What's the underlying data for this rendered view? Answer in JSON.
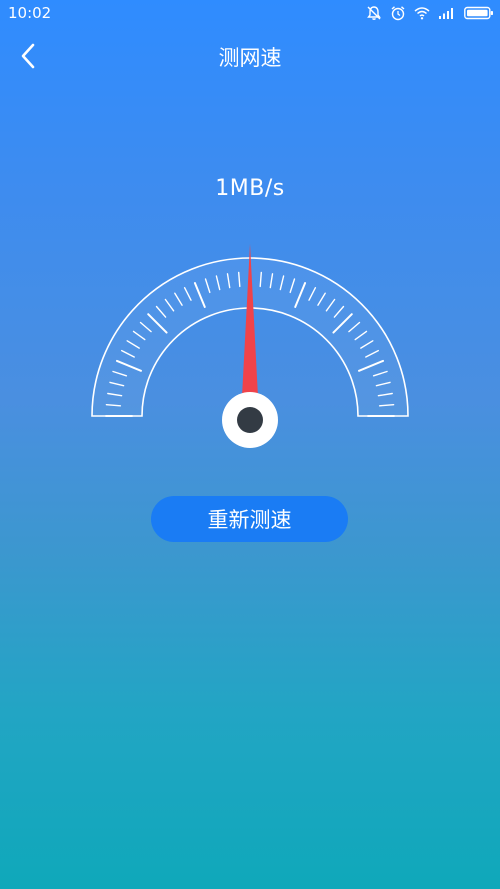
{
  "status_bar": {
    "time": "10:02",
    "icons": [
      "notifications-off-icon",
      "alarm-icon",
      "wifi-icon",
      "signal-icon",
      "battery-icon"
    ]
  },
  "header": {
    "back_icon": "chevron-left-icon",
    "title": "测网速"
  },
  "speed": {
    "readout": "1MB/s"
  },
  "gauge": {
    "needle_fraction": 0.5
  },
  "actions": {
    "retest_label": "重新测速"
  },
  "colors": {
    "needle": "#f0434a",
    "button": "#1a7cf4",
    "hub_inner": "#333b44"
  }
}
